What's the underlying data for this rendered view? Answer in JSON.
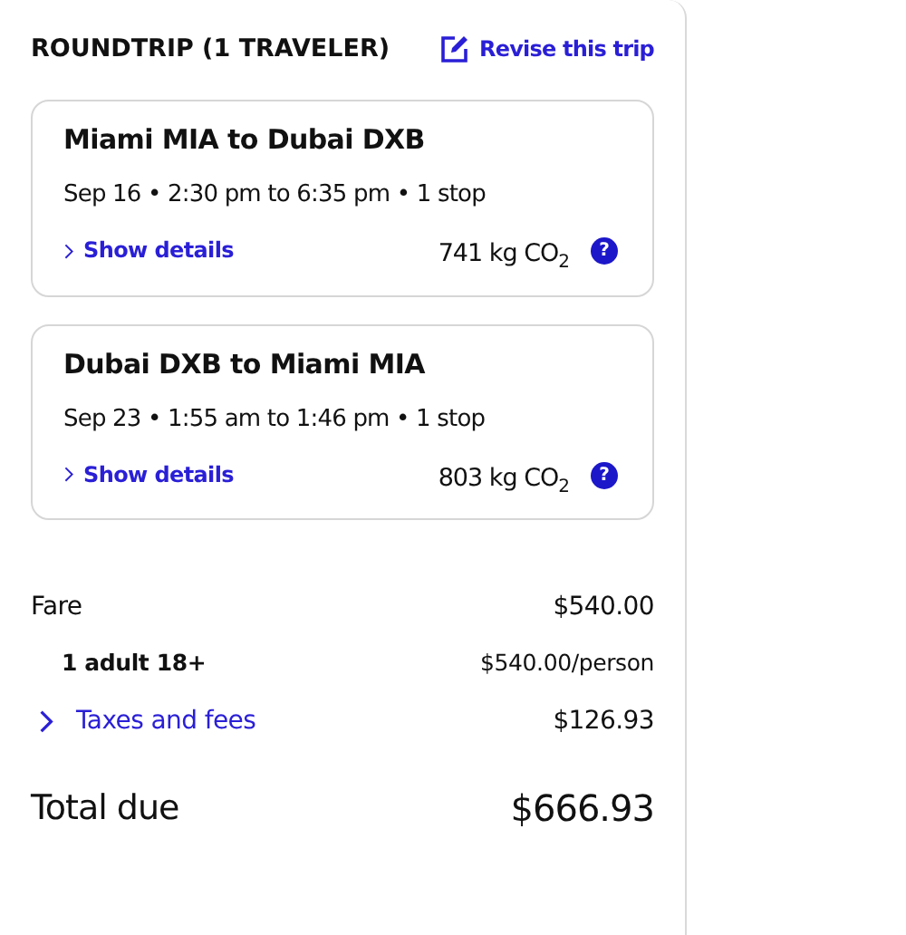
{
  "summary": {
    "title": "ROUNDTRIP (1 TRAVELER)",
    "revise_link": "Revise this trip"
  },
  "flights": [
    {
      "route": "Miami MIA to Dubai DXB",
      "schedule": "Sep 16 • 2:30 pm to 6:35 pm • 1 stop",
      "details_link": "Show details",
      "emissions": "741 kg CO$_{2}$",
      "help": "?"
    },
    {
      "route": "Dubai DXB to Miami MIA",
      "schedule": "Sep 23 • 1:55 am to 1:46 pm • 1 stop",
      "details_link": "Show details",
      "emissions": "803 kg CO$_{2}$",
      "help": "?"
    }
  ],
  "price_lines": [
    {
      "kind": "main",
      "label": "Fare",
      "amount": "$540.00"
    },
    {
      "kind": "sub",
      "label": "1 adult 18+",
      "amount": "$540.00/person"
    },
    {
      "kind": "expand",
      "label": "Taxes and fees",
      "amount": "$126.93"
    },
    {
      "kind": "total",
      "label": "Total due",
      "amount": "$666.93"
    }
  ]
}
